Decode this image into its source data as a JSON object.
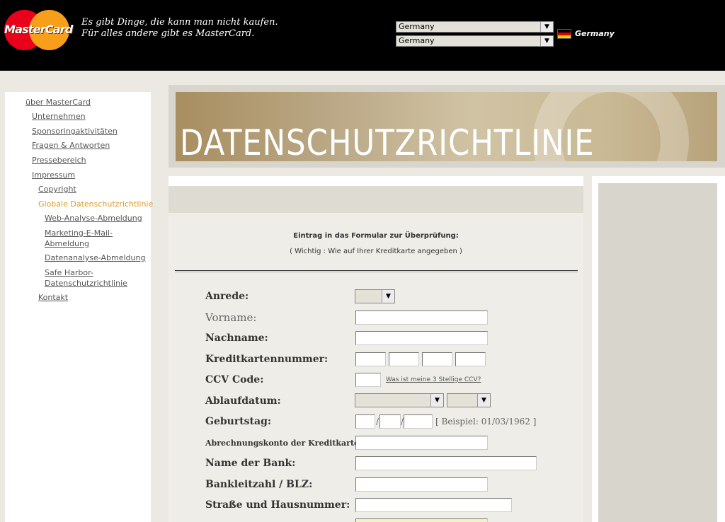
{
  "header": {
    "logo_text": "MasterCard",
    "tagline_line1": "Es gibt Dinge, die kann man nicht kaufen.",
    "tagline_line2": "Für alles andere gibt es MasterCard.",
    "country_select": "Germany",
    "language_select": "Germany",
    "flag_label": "Germany"
  },
  "sidebar": {
    "items": [
      {
        "label": "über MasterCard"
      },
      {
        "label": "Unternehmen"
      },
      {
        "label": "Sponsoringaktivitäten"
      },
      {
        "label": "Fragen & Antworten"
      },
      {
        "label": "Pressebereich"
      },
      {
        "label": "Impressum"
      },
      {
        "label": "Copyright"
      },
      {
        "label": "Globale Datenschutzrichtlinie"
      },
      {
        "label": "Web-Analyse-Abmeldung"
      },
      {
        "label": "Marketing-E-Mail-",
        "label2": "Abmeldung"
      },
      {
        "label": "Datenanalyse-Abmeldung"
      },
      {
        "label": "Safe Harbor-",
        "label2": "Datenschutzrichtlinie"
      },
      {
        "label": "Kontakt"
      }
    ]
  },
  "banner": {
    "title": "DATENSCHUTZRICHTLINIE"
  },
  "form": {
    "intro": "Eintrag in das Formular zur Überprüfung:",
    "note": "( Wichtig : Wie auf Ihrer Kreditkarte angegeben )",
    "labels": {
      "anrede": "Anrede:",
      "vorname": "Vorname:",
      "nachname": "Nachname:",
      "kartennummer": "Kreditkartennummer:",
      "ccv": "CCV Code:",
      "ablauf": "Ablaufdatum:",
      "geburtstag": "Geburtstag:",
      "konto": "Abrechnungskonto der Kreditkarte:",
      "bank": "Name der Bank:",
      "blz": "Bankleitzahl / BLZ:",
      "strasse": "Straße und Hausnummer:"
    },
    "ccv_link": "Was ist meine 3 Stellige CCV?",
    "birthday_slash": "/",
    "birthday_hint": "[ Beispiel: 01/03/1962 ]",
    "dropdown_arrow": "▼"
  }
}
